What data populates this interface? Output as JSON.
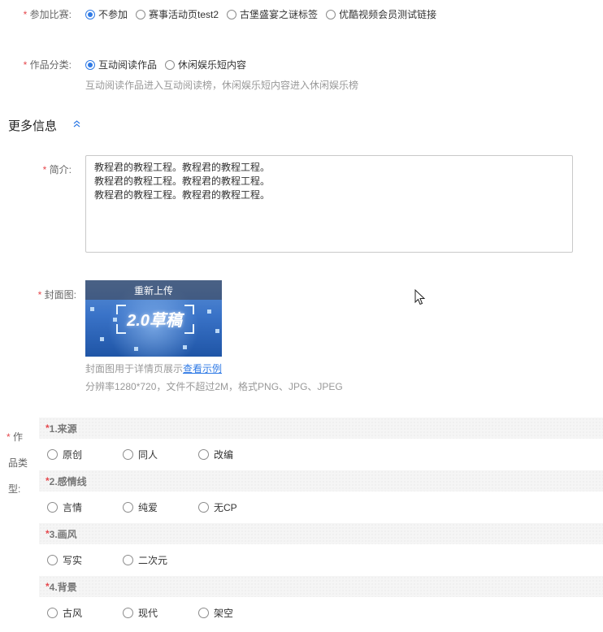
{
  "competition": {
    "label": "参加比赛:",
    "options": [
      "不参加",
      "赛事活动页test2",
      "古堡盛宴之谜标签",
      "优酷视频会员测试链接"
    ],
    "selected": "不参加"
  },
  "category": {
    "label": "作品分类:",
    "options": [
      "互动阅读作品",
      "休闲娱乐短内容"
    ],
    "selected": "互动阅读作品",
    "hint": "互动阅读作品进入互动阅读榜，休闲娱乐短内容进入休闲娱乐榜"
  },
  "more_info": {
    "title": "更多信息",
    "toggle_icon": "chevron-up-icon"
  },
  "intro": {
    "label": "简介:",
    "value": "教程君的教程工程。教程君的教程工程。\n教程君的教程工程。教程君的教程工程。\n教程君的教程工程。教程君的教程工程。"
  },
  "cover": {
    "label": "封面图:",
    "reupload": "重新上传",
    "image_text": "2.0草稿",
    "hint_prefix": "封面图用于详情页展示",
    "hint_link": "查看示例",
    "spec": "分辨率1280*720，文件不超过2M，格式PNG、JPG、JPEG"
  },
  "work_type": {
    "label_lines": [
      "作",
      "品类",
      "型:"
    ],
    "questions": [
      {
        "title": "1.来源",
        "options": [
          "原创",
          "同人",
          "改编"
        ]
      },
      {
        "title": "2.感情线",
        "options": [
          "言情",
          "纯爱",
          "无CP"
        ]
      },
      {
        "title": "3.画风",
        "options": [
          "写实",
          "二次元"
        ]
      },
      {
        "title": "4.背景",
        "options": [
          "古风",
          "现代",
          "架空"
        ]
      }
    ]
  },
  "colors": {
    "accent": "#2f7ae5",
    "required": "#e5484d"
  }
}
